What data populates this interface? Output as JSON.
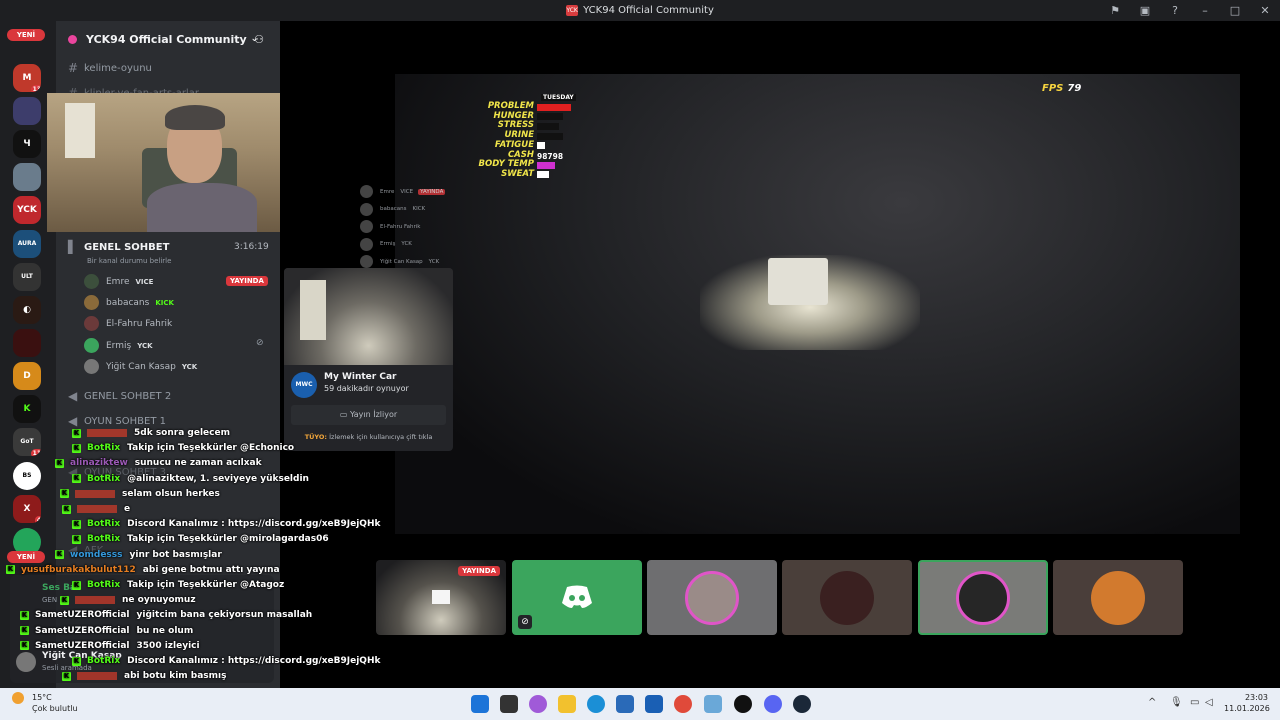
{
  "window": {
    "title": "YCK94 Official Community"
  },
  "rail": {
    "new_badge": "YENİ",
    "badge_13": "13",
    "badge_11": "11",
    "badge_4": "4",
    "new_badge2": "YENİ"
  },
  "server": {
    "name": "YCK94 Official Community"
  },
  "channels": {
    "text1": "kelime-oyunu",
    "text2": "klipler-ve-fan-arts-arlar",
    "voice_general": "GENEL SOHBET",
    "voice_timer": "3:16:19",
    "voice_status": "Bir kanal durumu belirle",
    "voice_general2": "GENEL SOHBET 2",
    "voice_game1": "OYUN SOHBET 1",
    "voice_game3": "OYUN SOHBET 3",
    "voice_afk": "AFK"
  },
  "voice_users": [
    {
      "name": "Emre",
      "tag": "VICE",
      "live": "YAYINDA"
    },
    {
      "name": "babacans",
      "tag": "KICK"
    },
    {
      "name": "El-Fahru Fahrik",
      "tag": ""
    },
    {
      "name": "Ermiş",
      "tag": "YCK"
    },
    {
      "name": "Yiğit Can Kasap",
      "tag": "YCK"
    }
  ],
  "hud": {
    "day": "TUESDAY",
    "labels": [
      "PROBLEM",
      "HUNGER",
      "STRESS",
      "URINE",
      "FATIGUE",
      "CASH",
      "BODY TEMP",
      "SWEAT"
    ],
    "cash": "98798",
    "fps_label": "FPS",
    "fps_value": "79"
  },
  "overlay_users": [
    {
      "name": "Emre",
      "tag": "VICE",
      "live": "YAYINDA"
    },
    {
      "name": "babacans",
      "tag": "KICK"
    },
    {
      "name": "El-Fahru Fahrik",
      "tag": ""
    },
    {
      "name": "Ermiş",
      "tag": "YCK"
    },
    {
      "name": "Yiğit Can Kasap",
      "tag": "YCK"
    }
  ],
  "popup": {
    "game": "My Winter Car",
    "game_icon": "MWC",
    "time": "59 dakikadır oynuyor",
    "watch": "Yayın İzliyor",
    "tip_label": "TÜYO:",
    "tip": "İzlemek için kullanıcıya çift tıkla"
  },
  "chat": [
    {
      "user": "",
      "msg": "5dk sonra gelecem",
      "ucolor": "#c0392b"
    },
    {
      "user": "BotRix",
      "msg": "Takip için Teşekkürler @Echonico",
      "ucolor": "#53fc18"
    },
    {
      "user": "alinaziktew",
      "msg": "sunucu ne zaman acılxak",
      "ucolor": "#9b59b6"
    },
    {
      "user": "BotRix",
      "msg": "@alinaziktew, 1. seviyeye yükseldin",
      "ucolor": "#53fc18"
    },
    {
      "user": "",
      "msg": "selam olsun herkes",
      "ucolor": "#c0392b"
    },
    {
      "user": "",
      "msg": "e",
      "ucolor": "#c0392b"
    },
    {
      "user": "BotRix",
      "msg": "Discord Kanalımız : https://discord.gg/xeB9JejQHk",
      "ucolor": "#53fc18"
    },
    {
      "user": "BotRix",
      "msg": "Takip için Teşekkürler @mirolagardas06",
      "ucolor": "#53fc18"
    },
    {
      "user": "womdesss",
      "msg": "yinr bot basmışlar",
      "ucolor": "#3498db"
    },
    {
      "user": "yusufburakakbulut112",
      "msg": "abi gene botmu attı yayına",
      "ucolor": "#e67e22"
    },
    {
      "user": "BotRix",
      "msg": "Takip için Teşekkürler @Atagoz",
      "ucolor": "#53fc18"
    },
    {
      "user": "",
      "msg": "ne oynuyomuz",
      "ucolor": "#c0392b"
    },
    {
      "user": "SametUZEROfficial",
      "msg": "yiğitcim bana çekiyorsun masallah",
      "ucolor": "#ffffff"
    },
    {
      "user": "SametUZEROfficial",
      "msg": "bu ne olum",
      "ucolor": "#ffffff"
    },
    {
      "user": "SametUZEROfficial",
      "msg": "3500 izleyici",
      "ucolor": "#ffffff"
    },
    {
      "user": "BotRix",
      "msg": "Discord Kanalımız : https://discord.gg/xeB9JejQHk",
      "ucolor": "#53fc18"
    },
    {
      "user": "",
      "msg": "abi botu kim basmış",
      "ucolor": "#c0392b"
    }
  ],
  "voice_panel": {
    "status": "Ses Ba",
    "sub": "GEN",
    "user": "Yiğit Can Kasap",
    "user_status": "Sesli aramada"
  },
  "tiles": {
    "live": "YAYINDA"
  },
  "taskbar": {
    "temp": "15°C",
    "weather": "Çok bulutlu",
    "time": "23:03",
    "date": "11.01.2026"
  },
  "colors": {
    "accent": "#5865f2",
    "live_red": "#da373c",
    "discord_green": "#3ba55d",
    "kick_green": "#53fc18"
  }
}
